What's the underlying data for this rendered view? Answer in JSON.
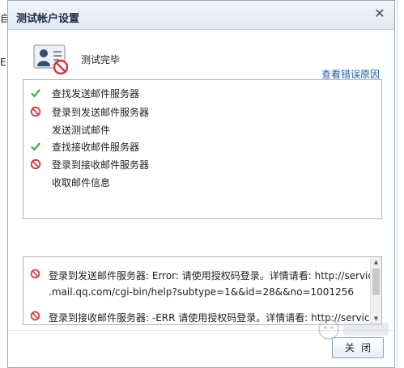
{
  "background": {
    "fragments": [
      "自",
      "E"
    ]
  },
  "dialog": {
    "title": "测试帐户设置",
    "close_glyph": "✕",
    "status_text": "测试完毕",
    "view_errors_link": "查看错误原因",
    "steps": [
      {
        "status": "ok",
        "label": "查找发送邮件服务器"
      },
      {
        "status": "error",
        "label": "登录到发送邮件服务器"
      },
      {
        "status": "none",
        "label": "发送测试邮件"
      },
      {
        "status": "ok",
        "label": "查找接收邮件服务器"
      },
      {
        "status": "error",
        "label": "登录到接收邮件服务器"
      },
      {
        "status": "none",
        "label": "收取邮件信息"
      }
    ],
    "log": [
      {
        "status": "error",
        "line1": "登录到发送邮件服务器: Error: 请使用授权码登录。详情请看: http://service",
        "line2": ".mail.qq.com/cgi-bin/help?subtype=1&&id=28&&no=1001256"
      },
      {
        "status": "error",
        "line1": "登录到接收邮件服务器: -ERR 请使用授权码登录。详情请看: http://service"
      }
    ],
    "close_button": "关闭"
  },
  "colors": {
    "ok_check": "#3aa84a",
    "error_icon": "#d9343a",
    "link": "#1f5fa8",
    "title": "#1d2f47"
  },
  "icons": {
    "status": "account-card-error-icon",
    "ok": "checkmark-icon",
    "error": "prohibited-icon"
  }
}
